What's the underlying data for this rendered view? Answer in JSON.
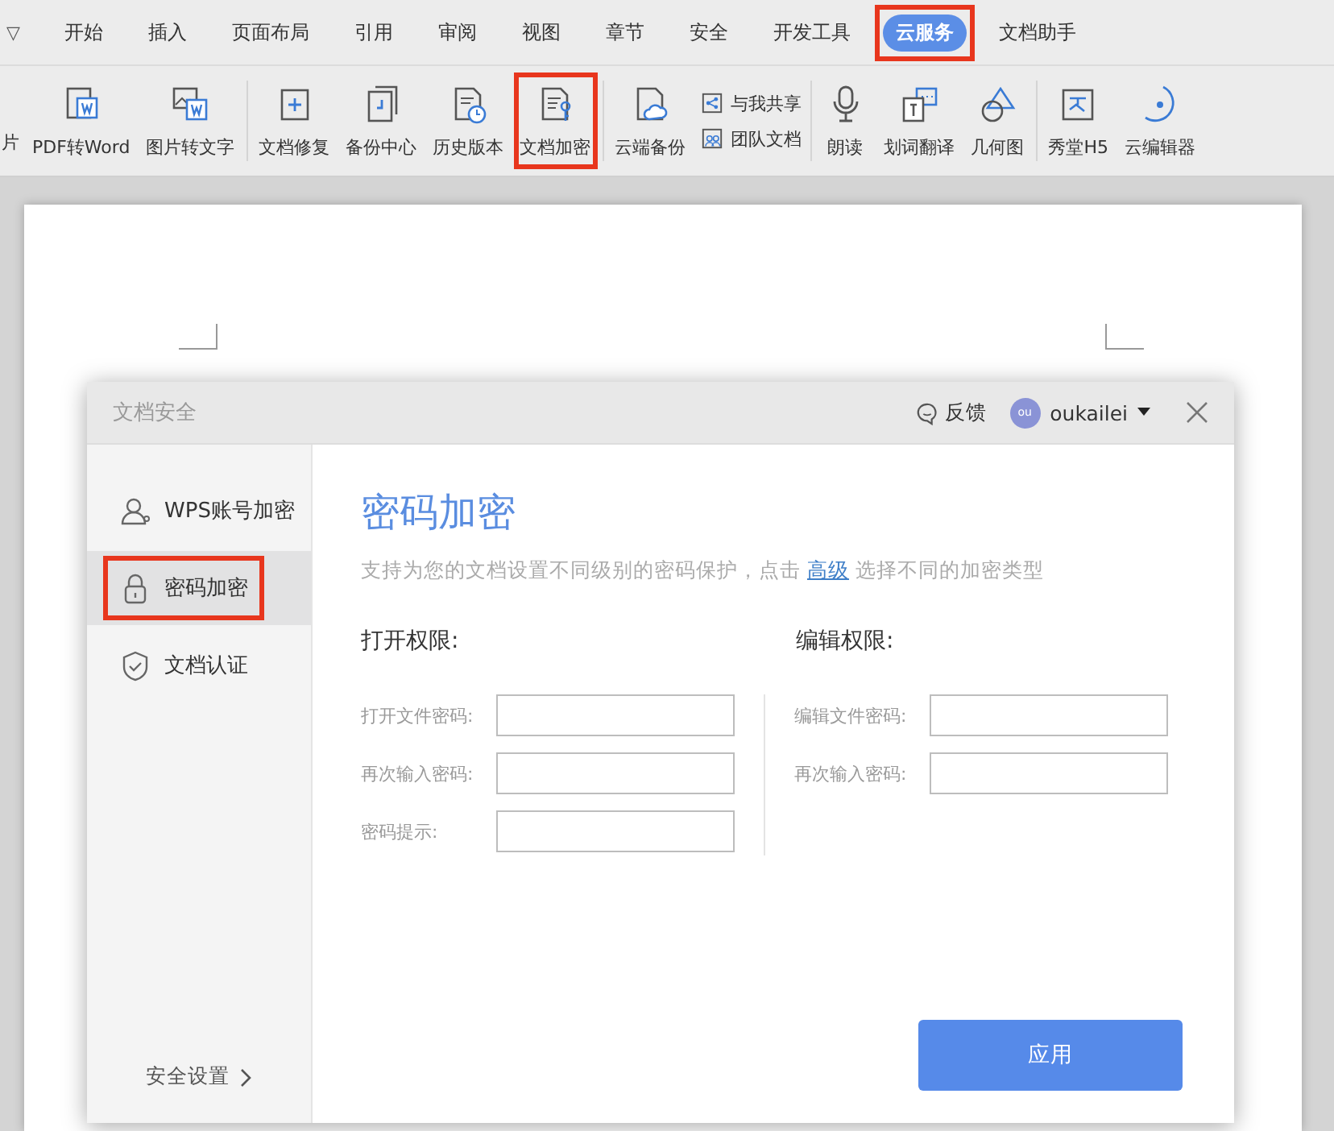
{
  "menu_toggle": "▽",
  "tabs": [
    {
      "label": "开始",
      "selected": false
    },
    {
      "label": "插入",
      "selected": false
    },
    {
      "label": "页面布局",
      "selected": false
    },
    {
      "label": "引用",
      "selected": false
    },
    {
      "label": "审阅",
      "selected": false
    },
    {
      "label": "视图",
      "selected": false
    },
    {
      "label": "章节",
      "selected": false
    },
    {
      "label": "安全",
      "selected": false
    },
    {
      "label": "开发工具",
      "selected": false
    },
    {
      "label": "云服务",
      "selected": true,
      "annotated": true
    },
    {
      "label": "文档助手",
      "selected": false
    }
  ],
  "ribbon_groups": [
    {
      "items": [
        {
          "kind": "partial",
          "label": "片"
        },
        {
          "kind": "large",
          "label": "PDF转Word"
        },
        {
          "kind": "large",
          "label": "图片转文字"
        }
      ]
    },
    {
      "items": [
        {
          "kind": "large",
          "label": "文档修复"
        },
        {
          "kind": "large",
          "label": "备份中心"
        },
        {
          "kind": "large",
          "label": "历史版本"
        },
        {
          "kind": "large",
          "label": "文档加密",
          "annotated": true
        }
      ]
    },
    {
      "items": [
        {
          "kind": "large",
          "label": "云端备份"
        },
        {
          "kind": "stack",
          "entries": [
            {
              "label": "与我共享"
            },
            {
              "label": "团队文档"
            }
          ]
        }
      ]
    },
    {
      "items": [
        {
          "kind": "large",
          "label": "朗读"
        },
        {
          "kind": "large",
          "label": "划词翻译"
        },
        {
          "kind": "large",
          "label": "几何图"
        }
      ]
    },
    {
      "items": [
        {
          "kind": "large",
          "label": "秀堂H5"
        },
        {
          "kind": "large",
          "label": "云编辑器"
        }
      ]
    }
  ],
  "dialog": {
    "title": "文档安全",
    "feedback": "反馈",
    "avatar": "ou",
    "user": "oukailei",
    "sidebar": [
      {
        "label": "WPS账号加密",
        "selected": false
      },
      {
        "label": "密码加密",
        "selected": true,
        "annotated": true
      },
      {
        "label": "文档认证",
        "selected": false
      }
    ],
    "settings_link": "安全设置",
    "heading": "密码加密",
    "description": {
      "before": "支持为您的文档设置不同级别的密码保护，点击",
      "link": "高级",
      "after": "选择不同的加密类型"
    },
    "sections": [
      {
        "title": "打开权限:",
        "fields": [
          {
            "label": "打开文件密码:"
          },
          {
            "label": "再次输入密码:"
          },
          {
            "label": "密码提示:"
          }
        ]
      },
      {
        "title": "编辑权限:",
        "fields": [
          {
            "label": "编辑文件密码:"
          },
          {
            "label": "再次输入密码:"
          }
        ]
      }
    ],
    "apply_button": "应用"
  }
}
